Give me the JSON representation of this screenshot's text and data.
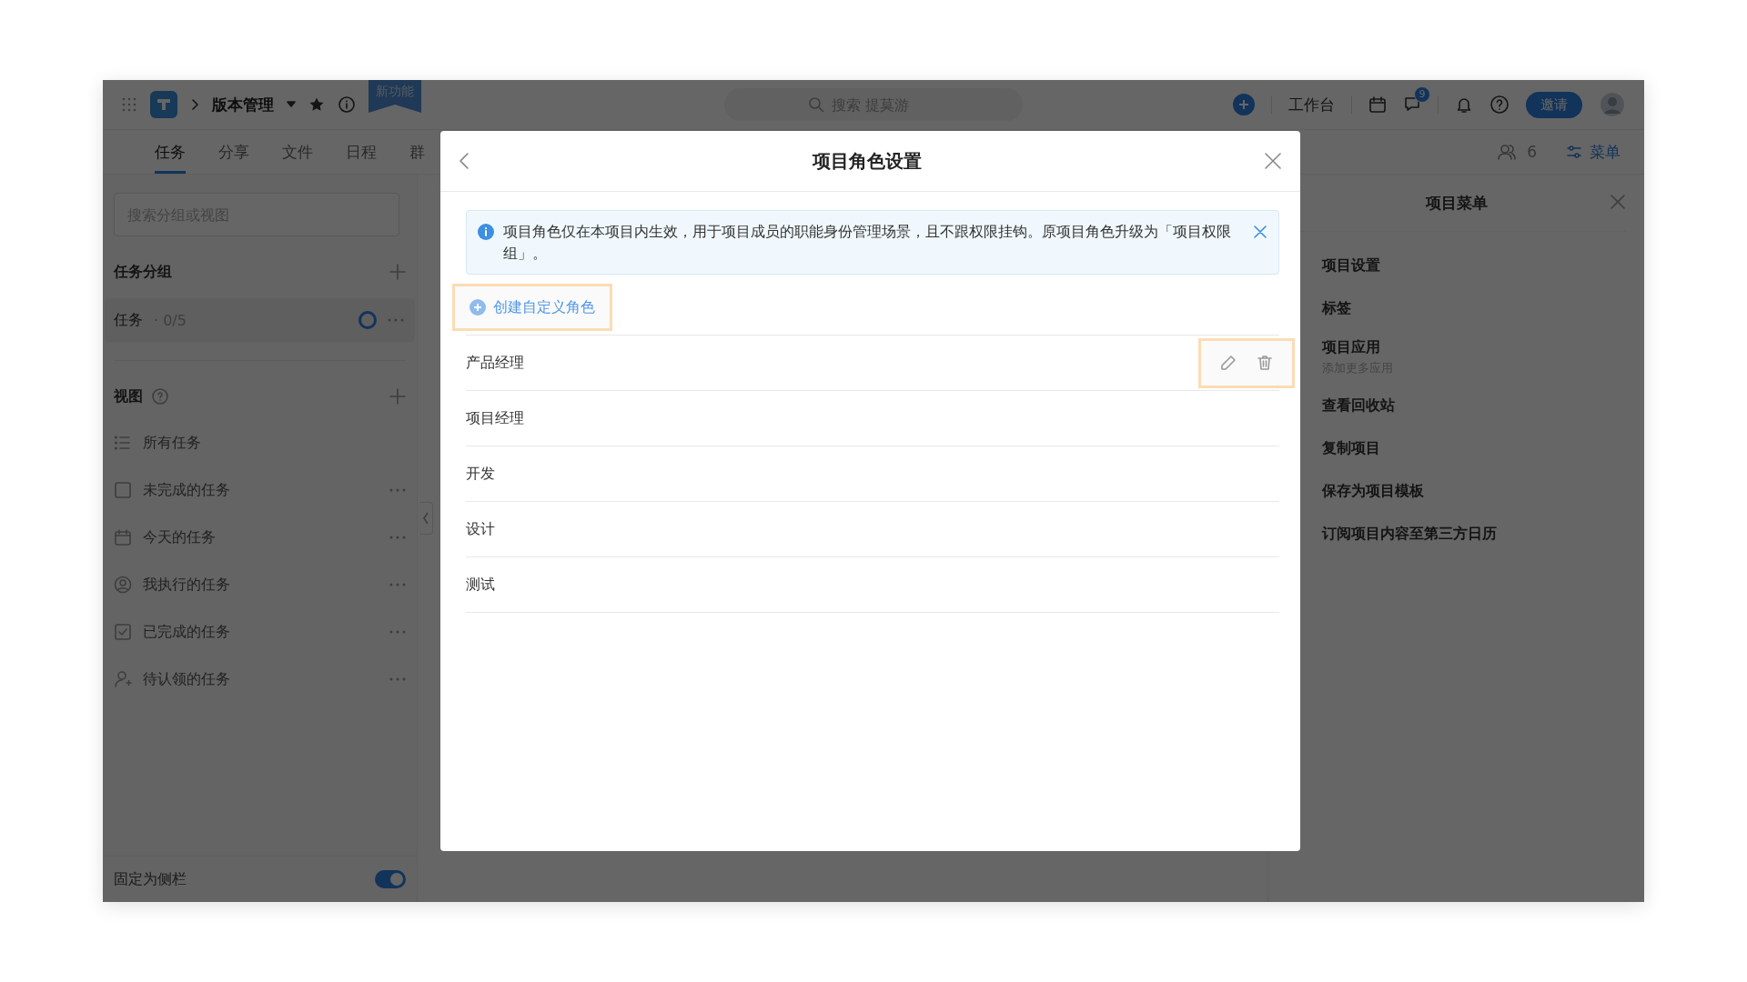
{
  "topbar": {
    "project": "版本管理",
    "ribbon": "新功能",
    "search": {
      "placeholder": "搜索 提莫游"
    },
    "workbench": "工作台",
    "message_badge": "9",
    "invite": "邀请"
  },
  "tabs": [
    {
      "label": "任务",
      "selected": true
    },
    {
      "label": "分享",
      "selected": false
    },
    {
      "label": "文件",
      "selected": false
    },
    {
      "label": "日程",
      "selected": false
    },
    {
      "label": "群",
      "selected": false
    }
  ],
  "members": "6",
  "menu": "菜单",
  "sidebar": {
    "search": {
      "placeholder": "搜索分组或视图"
    },
    "groups_title": "任务分组",
    "groups": [
      {
        "label": "任务",
        "count": "· 0/5"
      }
    ],
    "views_title": "视图",
    "views": [
      {
        "kind": "list",
        "label": "所有任务",
        "more": false
      },
      {
        "kind": "square",
        "label": "未完成的任务",
        "more": true
      },
      {
        "kind": "calendar",
        "label": "今天的任务",
        "more": true
      },
      {
        "kind": "person",
        "label": "我执行的任务",
        "more": true
      },
      {
        "kind": "checked",
        "label": "已完成的任务",
        "more": true
      },
      {
        "kind": "person-add",
        "label": "待认领的任务",
        "more": true
      }
    ],
    "pin": {
      "label": "固定为侧栏",
      "on": true
    }
  },
  "project_menu": {
    "title": "项目菜单",
    "items": [
      {
        "label": "项目设置"
      },
      {
        "label": "标签"
      },
      {
        "label": "项目应用",
        "subtitle": "添加更多应用"
      },
      {
        "label": "查看回收站"
      },
      {
        "label": "复制项目"
      },
      {
        "label": "保存为项目模板"
      },
      {
        "label": "订阅项目内容至第三方日历"
      }
    ]
  },
  "modal": {
    "title": "项目角色设置",
    "notice": "项目角色仅在本项目内生效，用于项目成员的职能身份管理场景，且不跟权限挂钩。原项目角色升级为「项目权限组」。",
    "create_button": {
      "label": "创建自定义角色",
      "highlighted": true
    },
    "roles": [
      {
        "name": "产品经理",
        "hovered": true
      },
      {
        "name": "项目经理",
        "hovered": false
      },
      {
        "name": "开发",
        "hovered": false
      },
      {
        "name": "设计",
        "hovered": false
      },
      {
        "name": "测试",
        "hovered": false
      }
    ]
  }
}
